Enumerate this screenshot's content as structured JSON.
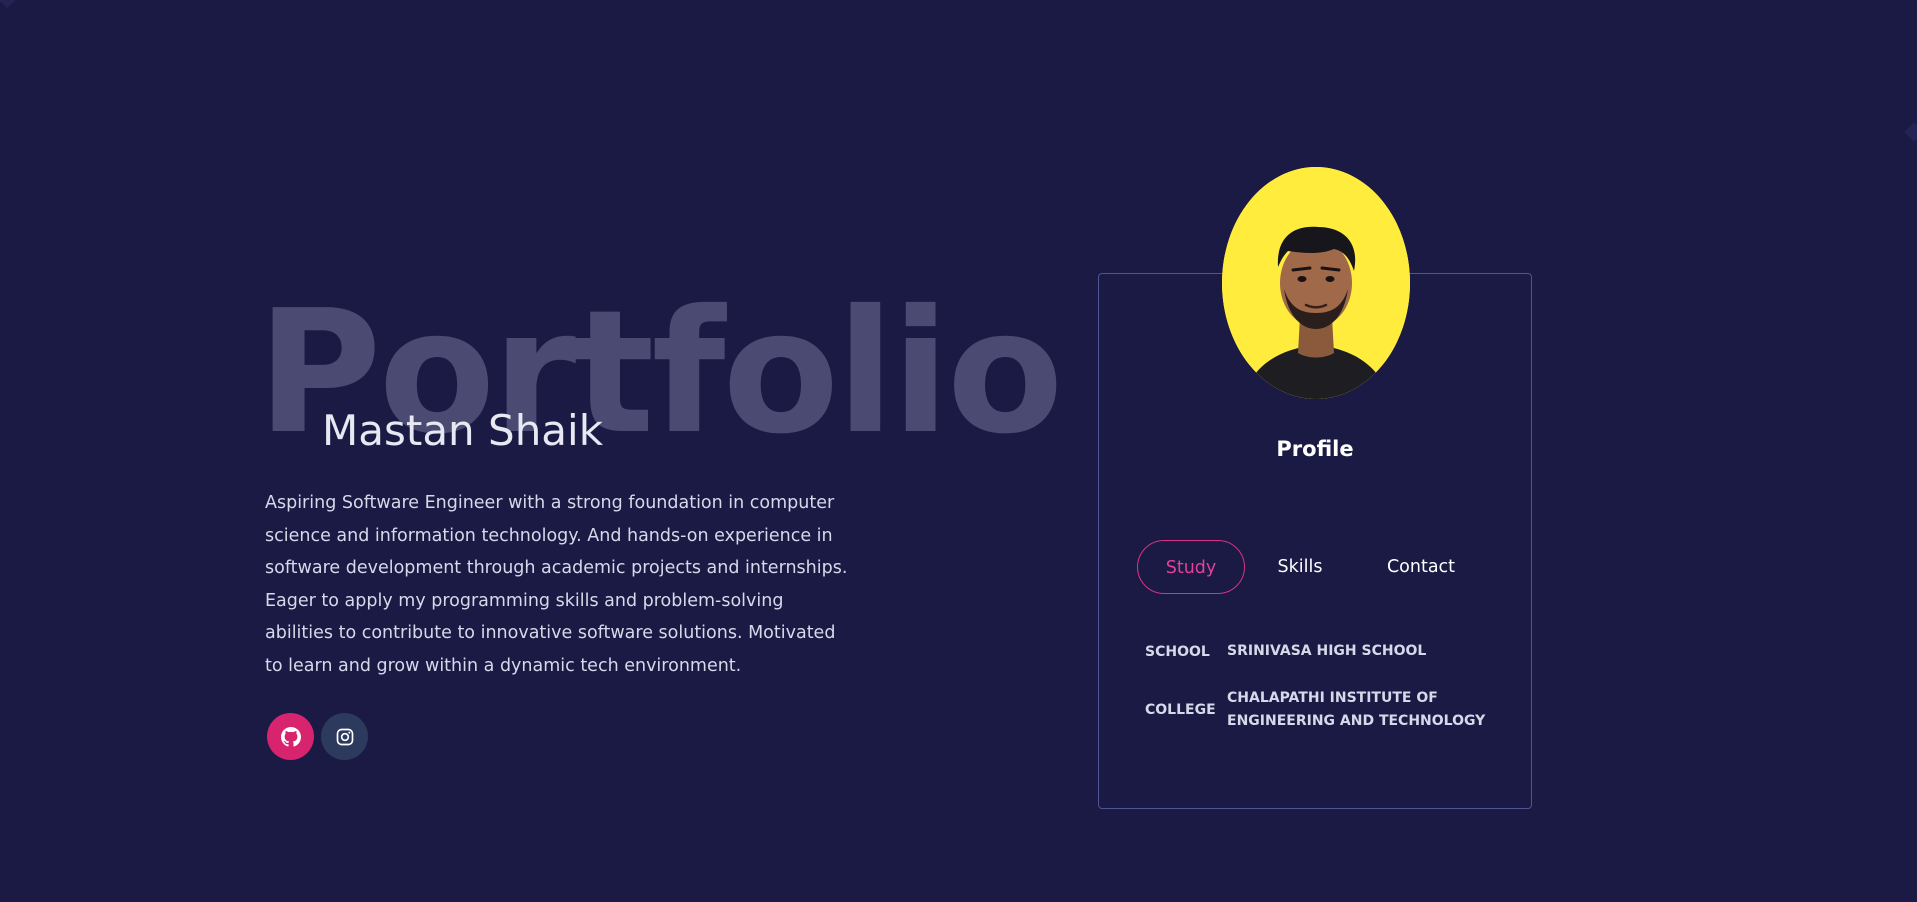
{
  "hero": {
    "background_word": "Portfolio",
    "name": "Mastan Shaik",
    "bio": "Aspiring Software Engineer with a strong foundation in computer science and information technology. And hands-on experience in software development through academic projects and internships. Eager to apply my programming skills and problem-solving abilities to contribute to innovative software solutions. Motivated to learn and grow within a dynamic tech environment."
  },
  "socials": [
    {
      "icon": "github-icon"
    },
    {
      "icon": "instagram-icon"
    }
  ],
  "profile_card": {
    "title": "Profile",
    "tabs": [
      {
        "label": "Study",
        "active": true
      },
      {
        "label": "Skills",
        "active": false
      },
      {
        "label": "Contact",
        "active": false
      }
    ],
    "study": [
      {
        "key": "SCHOOL",
        "value": "SRINIVASA HIGH SCHOOL"
      },
      {
        "key": "COLLEGE",
        "value": "CHALAPATHI INSTITUTE OF ENGINEERING AND TECHNOLOGY"
      }
    ]
  },
  "colors": {
    "background": "#1a1a44",
    "accent_pink": "#d63384",
    "avatar_bg": "#ffec3d",
    "card_border": "#4d5592"
  }
}
